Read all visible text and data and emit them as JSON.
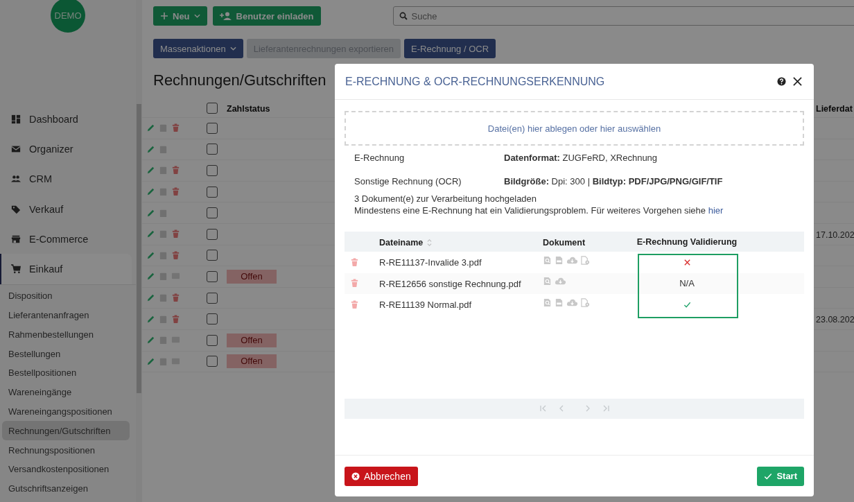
{
  "logo": {
    "text": "DEMO"
  },
  "sidebar": {
    "items": [
      {
        "label": "Dashboard",
        "kind": "dashboard",
        "selected": false
      },
      {
        "label": "Organizer",
        "kind": "organizer",
        "selected": false
      },
      {
        "label": "CRM",
        "kind": "crm",
        "selected": false
      },
      {
        "label": "Verkauf",
        "kind": "sales",
        "selected": false
      },
      {
        "label": "E-Commerce",
        "kind": "shop",
        "selected": false
      },
      {
        "label": "Einkauf",
        "kind": "purchase",
        "selected": true
      }
    ],
    "subitems": [
      {
        "label": "Disposition",
        "selected": false
      },
      {
        "label": "Lieferantenanfragen",
        "selected": false
      },
      {
        "label": "Rahmenbestellungen",
        "selected": false
      },
      {
        "label": "Bestellungen",
        "selected": false
      },
      {
        "label": "Bestellpositionen",
        "selected": false
      },
      {
        "label": "Wareneingänge",
        "selected": false
      },
      {
        "label": "Wareneingangspositionen",
        "selected": false
      },
      {
        "label": "Rechnungen/Gutschriften",
        "selected": true
      },
      {
        "label": "Rechnungspositionen",
        "selected": false
      },
      {
        "label": "Versandkostenpositionen",
        "selected": false
      },
      {
        "label": "Gutschriftsanzeigen",
        "selected": false
      }
    ]
  },
  "toolbar": {
    "buttons": [
      {
        "label": "Neu",
        "kind": "create"
      },
      {
        "label": "Benutzer einladen",
        "kind": "invite"
      }
    ],
    "search": {
      "placeholder": "Suche"
    }
  },
  "actions": [
    {
      "label": "Massenaktionen",
      "kind": "dropdown",
      "disabled": false
    },
    {
      "label": "Lieferantenrechnungen exportieren",
      "kind": "plain",
      "disabled": true
    },
    {
      "label": "E-Rechnung / OCR",
      "kind": "plain",
      "disabled": false
    }
  ],
  "page": {
    "title": "Rechnungen/Gutschriften"
  },
  "table": {
    "columns": [
      "Zahlstatus",
      "Lieferdat"
    ],
    "header_checked": false,
    "rows": [
      {
        "checked": false,
        "deletable": true
      },
      {
        "checked": false,
        "deletable": false
      },
      {
        "checked": false,
        "deletable": true
      },
      {
        "checked": false,
        "deletable": true
      },
      {
        "checked": false,
        "deletable": false
      },
      {
        "checked": false,
        "deletable": true,
        "date": "17.10.202"
      },
      {
        "checked": false,
        "deletable": true
      },
      {
        "checked": false,
        "deletable": false,
        "status": "Offen"
      },
      {
        "checked": false,
        "deletable": true
      },
      {
        "checked": false,
        "deletable": true,
        "date": "23.08.202"
      },
      {
        "checked": false,
        "deletable": false,
        "status": "Offen"
      },
      {
        "checked": false,
        "deletable": false,
        "status": "Offen"
      }
    ]
  },
  "dialog": {
    "title": "E-RECHNUNG & OCR-RECHNUNGSERKENNUNG",
    "dropzone": "Datei(en) hier ablegen oder hier auswählen",
    "info": [
      {
        "label": "E-Rechnung",
        "value": "**Datenformat:** ZUGFeRD, XRechnung"
      },
      {
        "label": "Sonstige Rechnung (OCR)",
        "value": "**Bildgröße:** Dpi: 300 | **Bildtyp: PDF/JPG/PNG/GIF/TIF**"
      }
    ],
    "upload_message": "3 Dokument(e) zur Verarbeitung hochgeladen",
    "warning": "Mindestens eine E-Rechnung hat ein Validierungsproblem. Für weiteres Vorgehen siehe",
    "warning_link": "hier",
    "columns": [
      "Dateiname",
      "Dokument",
      "E-Rechnung Validierung"
    ],
    "files": [
      {
        "name": "R-RE11137-Invalide 3.pdf",
        "has_pdf": true,
        "has_details": true,
        "valid": false
      },
      {
        "name": "R-RE12656 sonstige Rechnung.pdf",
        "has_pdf": false,
        "has_details": false,
        "validation_text": "N/A"
      },
      {
        "name": "R-RE11139 Normal.pdf",
        "has_pdf": true,
        "has_details": true,
        "valid": true
      }
    ],
    "pager": {
      "disabled": true
    },
    "cancel": "Abbrechen",
    "start": "Start"
  }
}
